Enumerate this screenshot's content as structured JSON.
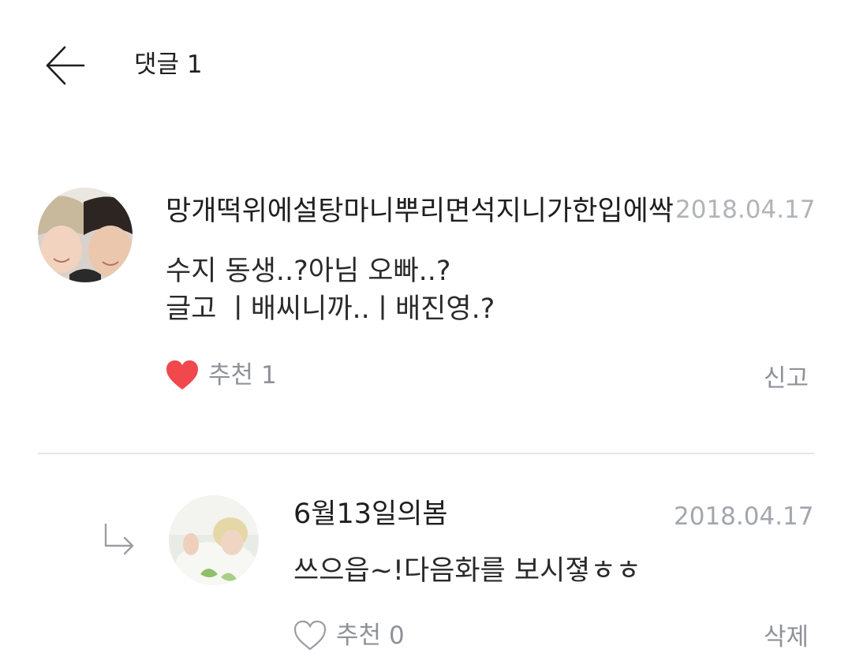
{
  "header": {
    "title": "댓글 1"
  },
  "comments": [
    {
      "author": "망개떡위에설탕마니뿌리면석지니가한입에싹",
      "date": "2018.04.17",
      "text_lines": [
        "수지 동생..?아님 오빠..?",
        "글고  ㅣ배씨니까..ㅣ배진영.?"
      ],
      "like_label": "추천",
      "like_count": "1",
      "liked": true,
      "action": "신고"
    }
  ],
  "replies": [
    {
      "author": "6월13일의봄",
      "date": "2018.04.17",
      "text": "쓰으읍~!다음화를 보시졓ㅎㅎ",
      "like_label": "추천",
      "like_count": "0",
      "liked": false,
      "action": "삭제"
    }
  ],
  "colors": {
    "heart_active": "#f0484d",
    "heart_inactive": "#9a9ea4",
    "muted_text": "#8e9298",
    "date_text": "#a3a7ad",
    "divider": "#e6e6e6"
  },
  "icons": {
    "back": "back-arrow-icon",
    "like": "heart-icon",
    "reply": "reply-arrow-icon"
  }
}
